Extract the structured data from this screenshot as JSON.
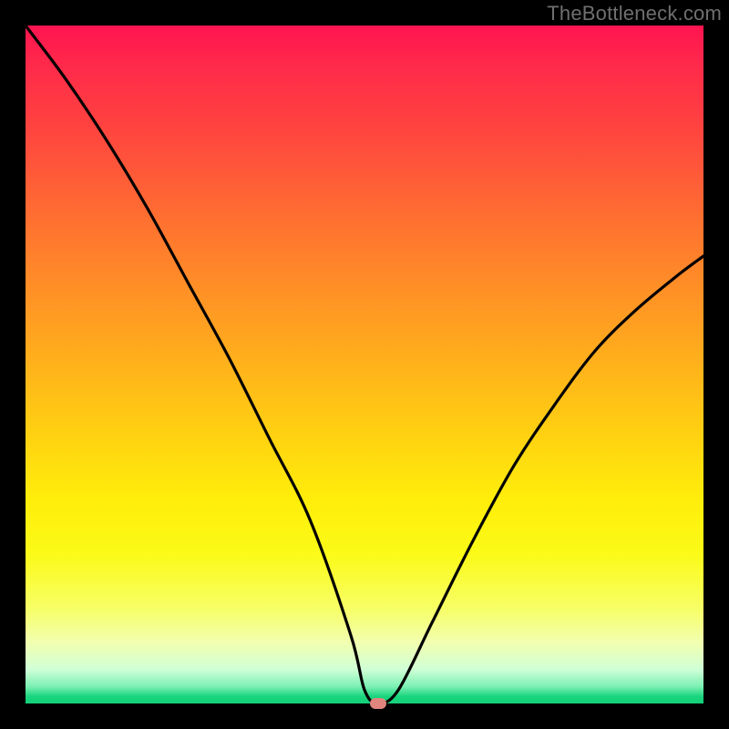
{
  "watermark": "TheBottleneck.com",
  "colors": {
    "page_bg": "#000000",
    "curve": "#000000",
    "marker": "#e0857e",
    "watermark": "#6f6f6f",
    "gradient_top": "#ff1450",
    "gradient_bottom": "#14d07a"
  },
  "chart_data": {
    "type": "line",
    "title": "",
    "xlabel": "",
    "ylabel": "",
    "xlim": [
      0,
      100
    ],
    "ylim": [
      0,
      100
    ],
    "grid": false,
    "legend": false,
    "series": [
      {
        "name": "bottleneck-curve",
        "x": [
          0,
          6,
          12,
          18,
          24,
          30,
          36,
          42,
          48,
          50,
          52,
          55,
          60,
          66,
          72,
          78,
          84,
          90,
          96,
          100
        ],
        "values": [
          100,
          92,
          83,
          73,
          62,
          51,
          39,
          27,
          10,
          2,
          0,
          2,
          12,
          24,
          35,
          44,
          52,
          58,
          63,
          66
        ]
      }
    ],
    "marker": {
      "x": 52,
      "y": 0
    }
  }
}
